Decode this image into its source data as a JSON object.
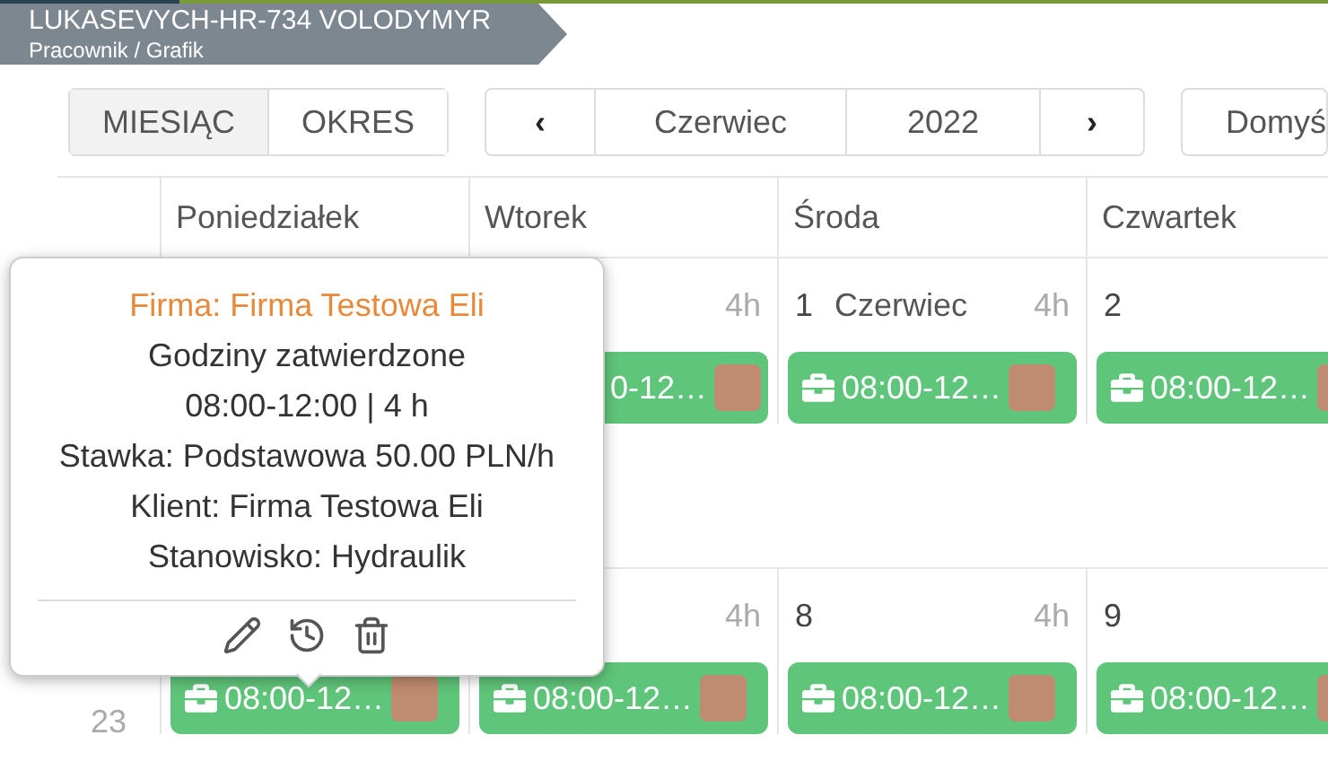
{
  "header": {
    "name": "LUKASEVYCH-HR-734 VOLODYMYR",
    "subtitle": "Pracownik / Grafik"
  },
  "view_tabs": [
    {
      "label": "MIESIĄC",
      "selected": true
    },
    {
      "label": "OKRES",
      "selected": false
    }
  ],
  "navigator": {
    "prev": "‹",
    "month": "Czerwiec",
    "year": "2022",
    "next": "›"
  },
  "view_select": "Domyś",
  "calendar": {
    "columns": [
      "Poniedziałek",
      "Wtorek",
      "Środa",
      "Czwartek"
    ],
    "weeks": [
      {
        "cells": [
          {},
          {
            "hours": "4h",
            "event": {
              "text": "0-12…",
              "icon": false
            }
          },
          {
            "day": "1",
            "month": "Czerwiec",
            "hours": "4h",
            "event": {
              "text": "08:00-12…",
              "icon": true
            }
          },
          {
            "day": "2",
            "event": {
              "text": "08:00-12…",
              "icon": true
            }
          }
        ]
      },
      {
        "number": "23",
        "cells": [
          {
            "event": {
              "text": "08:00-12…",
              "icon": true
            }
          },
          {
            "hours": "4h",
            "event": {
              "text": "08:00-12…",
              "icon": true
            }
          },
          {
            "day": "8",
            "hours": "4h",
            "event": {
              "text": "08:00-12…",
              "icon": true
            }
          },
          {
            "day": "9",
            "event": {
              "text": "08:00-12…",
              "icon": true
            }
          }
        ]
      }
    ]
  },
  "popover": {
    "title": "Firma: Firma Testowa Eli",
    "lines": [
      "Godziny zatwierdzone",
      "08:00-12:00 | 4 h",
      "Stawka: Podstawowa 50.00 PLN/h",
      "Klient: Firma Testowa Eli",
      "Stanowisko: Hydraulik"
    ]
  }
}
